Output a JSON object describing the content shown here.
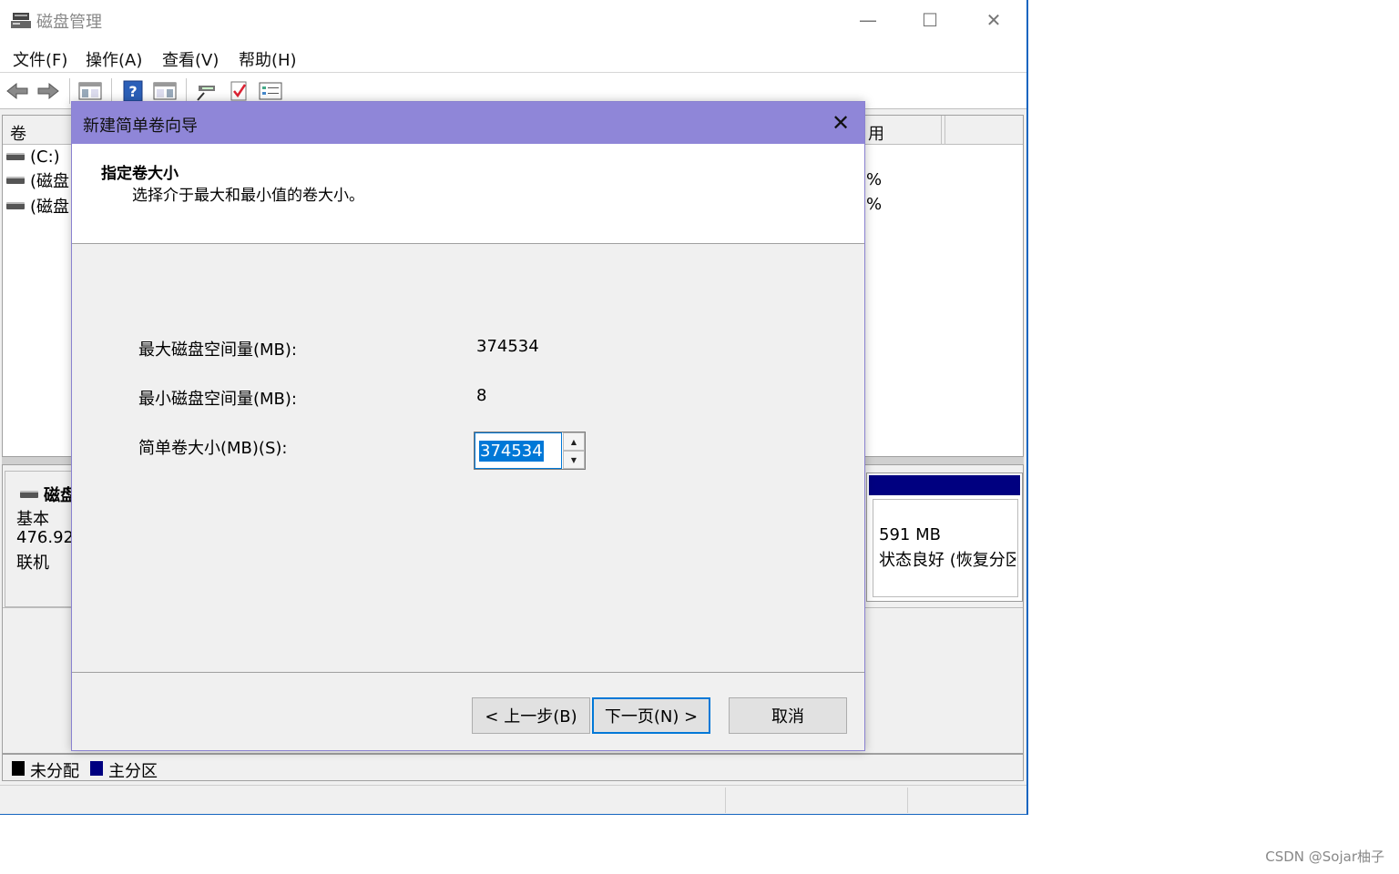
{
  "app": {
    "title": "磁盘管理",
    "minimize": "—",
    "maximize": "☐",
    "close": "✕"
  },
  "menu": [
    "文件(F)",
    "操作(A)",
    "查看(V)",
    "帮助(H)"
  ],
  "toolbar": {
    "icons": [
      "back-arrow-icon",
      "forward-arrow-icon",
      "console-tree-icon",
      "help-icon",
      "action-pane-icon",
      "connect-icon",
      "check-icon",
      "properties-icon"
    ]
  },
  "volume_list": {
    "headers": [
      "卷",
      "用"
    ],
    "rows": [
      {
        "name": "(C:)",
        "pct": ""
      },
      {
        "name": "(磁盘",
        "pct": "%"
      },
      {
        "name": "(磁盘",
        "pct": "%"
      }
    ]
  },
  "disk": {
    "label": "磁盘",
    "type": "基本",
    "size": "476.92",
    "status": "联机"
  },
  "partition": {
    "size": "591 MB",
    "status": "状态良好 (恢复分区"
  },
  "legend": [
    {
      "label": "未分配",
      "color": "#000000"
    },
    {
      "label": "主分区",
      "color": "#000080"
    }
  ],
  "wizard": {
    "title": "新建简单卷向导",
    "close": "✕",
    "heading": "指定卷大小",
    "subheading": "选择介于最大和最小值的卷大小。",
    "max_label": "最大磁盘空间量(MB):",
    "max_value": "374534",
    "min_label": "最小磁盘空间量(MB):",
    "min_value": "8",
    "size_label": "简单卷大小(MB)(S):",
    "size_value": "374534",
    "spin_up": "▲",
    "spin_down": "▼",
    "back_button": "< 上一步(B)",
    "next_button": "下一页(N) >",
    "cancel_button": "取消"
  },
  "watermark": "CSDN @Sojar柚子"
}
